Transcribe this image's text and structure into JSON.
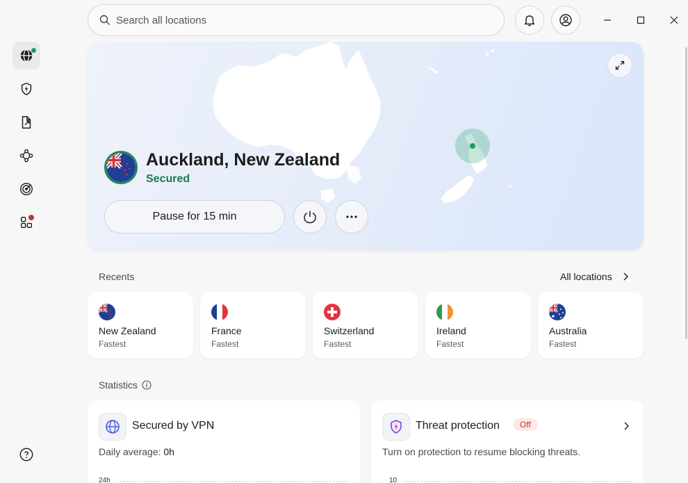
{
  "search": {
    "placeholder": "Search all locations"
  },
  "hero": {
    "location": "Auckland, New Zealand",
    "status": "Secured",
    "pause_label": "Pause for 15 min",
    "more_label": "···"
  },
  "recents": {
    "label": "Recents",
    "all_locations": "All locations",
    "items": [
      {
        "name": "New Zealand",
        "sub": "Fastest",
        "flag": "nz-flag-icon"
      },
      {
        "name": "France",
        "sub": "Fastest",
        "flag": "france-flag-icon"
      },
      {
        "name": "Switzerland",
        "sub": "Fastest",
        "flag": "switzerland-flag-icon"
      },
      {
        "name": "Ireland",
        "sub": "Fastest",
        "flag": "ireland-flag-icon"
      },
      {
        "name": "Australia",
        "sub": "Fastest",
        "flag": "australia-flag-icon"
      }
    ]
  },
  "statistics": {
    "label": "Statistics",
    "vpn": {
      "title": "Secured by VPN",
      "daily_label": "Daily average: ",
      "daily_value": "0h",
      "axis_top": "24h"
    },
    "threat": {
      "title": "Threat protection",
      "badge": "Off",
      "desc": "Turn on protection to resume blocking threats.",
      "axis_top": "10"
    }
  },
  "colors": {
    "secured": "#1a7a4c",
    "accent": "#0a7a5c",
    "badge_bg": "#fde8e6",
    "badge_fg": "#c0392b"
  }
}
